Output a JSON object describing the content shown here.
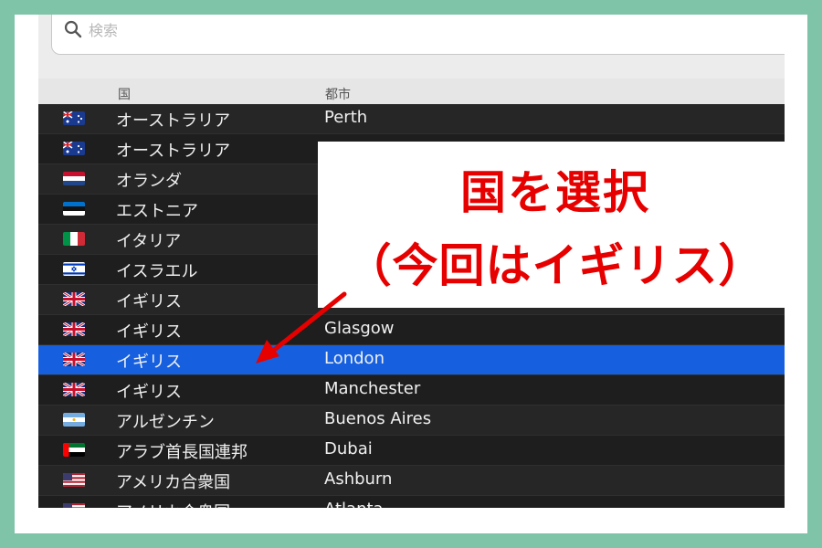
{
  "search": {
    "placeholder": "検索"
  },
  "table": {
    "headers": {
      "country": "国",
      "city": "都市"
    },
    "rows": [
      {
        "flag": "australia-flag-icon",
        "country": "オーストラリア",
        "city": "Perth",
        "selected": false
      },
      {
        "flag": "australia-flag-icon",
        "country": "オーストラリア",
        "city": "",
        "selected": false
      },
      {
        "flag": "netherlands-flag-icon",
        "country": "オランダ",
        "city": "",
        "selected": false
      },
      {
        "flag": "estonia-flag-icon",
        "country": "エストニア",
        "city": "",
        "selected": false
      },
      {
        "flag": "italy-flag-icon",
        "country": "イタリア",
        "city": "",
        "selected": false
      },
      {
        "flag": "israel-flag-icon",
        "country": "イスラエル",
        "city": "",
        "selected": false
      },
      {
        "flag": "uk-flag-icon",
        "country": "イギリス",
        "city": "",
        "selected": false
      },
      {
        "flag": "uk-flag-icon",
        "country": "イギリス",
        "city": "Glasgow",
        "selected": false
      },
      {
        "flag": "uk-flag-icon",
        "country": "イギリス",
        "city": "London",
        "selected": true
      },
      {
        "flag": "uk-flag-icon",
        "country": "イギリス",
        "city": "Manchester",
        "selected": false
      },
      {
        "flag": "argentina-flag-icon",
        "country": "アルゼンチン",
        "city": "Buenos Aires",
        "selected": false
      },
      {
        "flag": "uae-flag-icon",
        "country": "アラブ首長国連邦",
        "city": "Dubai",
        "selected": false
      },
      {
        "flag": "usa-flag-icon",
        "country": "アメリカ合衆国",
        "city": "Ashburn",
        "selected": false
      },
      {
        "flag": "usa-flag-icon",
        "country": "アメリカ合衆国",
        "city": "Atlanta",
        "selected": false
      }
    ]
  },
  "annotation": {
    "line1": "国を選択",
    "line2": "（今回はイギリス）"
  },
  "colors": {
    "frame": "#7fc3a9",
    "selected_row": "#1660e0",
    "annotation_text": "#e60000"
  }
}
